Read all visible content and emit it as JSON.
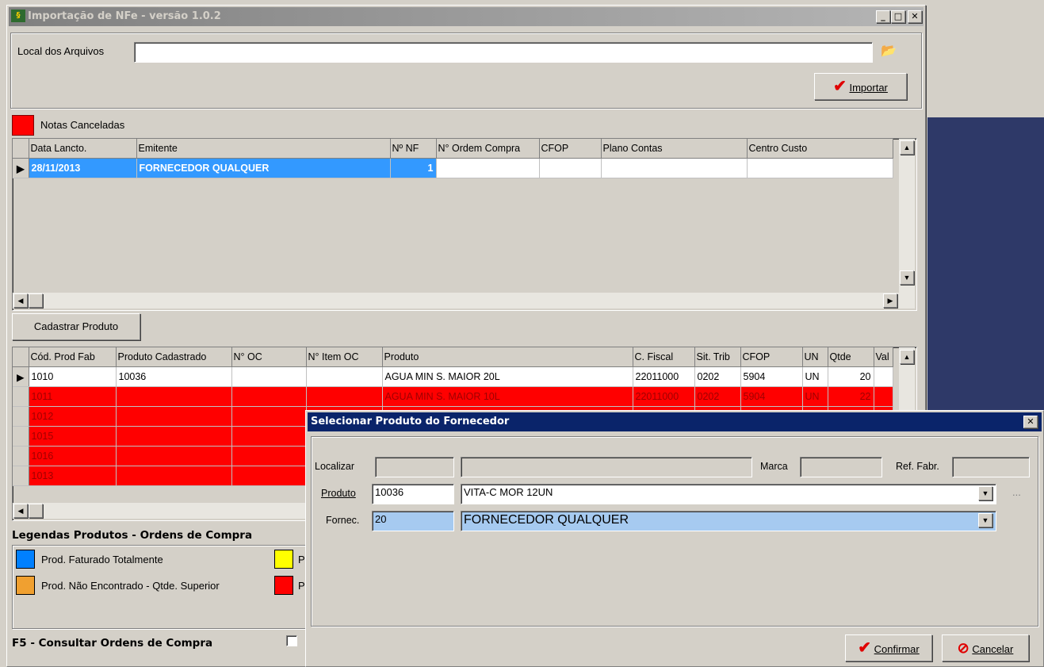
{
  "main_window": {
    "title": "Importação de NFe - versão 1.0.2",
    "local_label": "Local dos Arquivos",
    "local_value": "",
    "import_button": "Importar",
    "cancel_legend": "Notas Canceladas",
    "notes_grid": {
      "columns": [
        "Data Lancto.",
        "Emitente",
        "Nº NF",
        "N° Ordem Compra",
        "CFOP",
        "Plano Contas",
        "Centro Custo"
      ],
      "rows": [
        {
          "data": "28/11/2013",
          "emitente": "FORNECEDOR QUALQUER",
          "nf": "1",
          "oc": "",
          "cfop": "",
          "plano": "",
          "centro": ""
        }
      ]
    },
    "register_button": "Cadastrar Produto",
    "products_grid": {
      "columns": [
        "Cód. Prod Fab",
        "Produto Cadastrado",
        "N° OC",
        "N° Item OC",
        "Produto",
        "C. Fiscal",
        "Sit. Trib",
        "CFOP",
        "UN",
        "Qtde",
        "Val"
      ],
      "rows": [
        {
          "cod": "1010",
          "cad": "10036",
          "oc": "",
          "item": "",
          "prod": "AGUA MIN S. MAIOR 20L",
          "fiscal": "22011000",
          "trib": "0202",
          "cfop": "5904",
          "un": "UN",
          "qtde": "20"
        },
        {
          "cod": "1011",
          "cad": "",
          "oc": "",
          "item": "",
          "prod": "AGUA MIN S. MAIOR 10L",
          "fiscal": "22011000",
          "trib": "0202",
          "cfop": "5904",
          "un": "UN",
          "qtde": "22"
        },
        {
          "cod": "1012"
        },
        {
          "cod": "1015"
        },
        {
          "cod": "1016"
        },
        {
          "cod": "1013"
        }
      ]
    },
    "legend_title": "Legendas Produtos - Ordens de Compra",
    "legend_items": [
      {
        "label": "Prod. Faturado Totalmente",
        "color": "#0080ff"
      },
      {
        "label": "P",
        "color": "#ffff00"
      },
      {
        "label": "Prod. Não Encontrado - Qtde. Superior",
        "color": "#f0a030"
      },
      {
        "label": "P",
        "color": "#ff0000"
      }
    ],
    "f5_label": "F5 - Consultar Ordens de Compra"
  },
  "dialog": {
    "title": "Selecionar Produto do Fornecedor",
    "localizar_label": "Localizar",
    "marca_label": "Marca",
    "ref_label": "Ref. Fabr.",
    "produto_label": "Produto",
    "produto_code": "10036",
    "produto_name": "VITA-C MOR 12UN",
    "fornec_label": "Fornec.",
    "fornec_code": "20",
    "fornec_name": "FORNECEDOR QUALQUER",
    "ellipsis": "...",
    "confirm_button": "Confirmar",
    "cancel_button": "Cancelar"
  },
  "colors": {
    "selection": "#3399ff",
    "cancelled": "#ff0000",
    "desktop": "#2e3968",
    "dialog_title": "#0a246a"
  }
}
